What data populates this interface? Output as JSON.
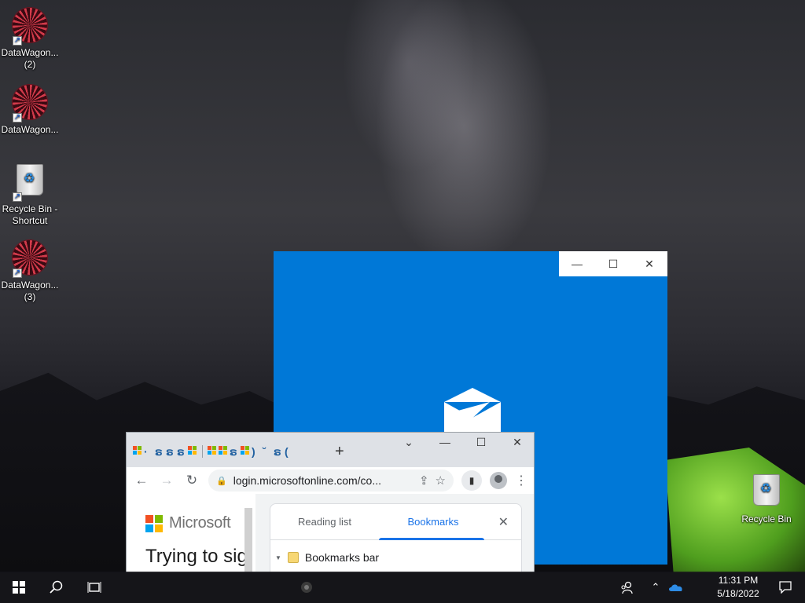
{
  "desktop": {
    "icons": [
      {
        "label_line1": "DataWagon...",
        "label_line2": "(2)",
        "icon": "datawagon-icon"
      },
      {
        "label_line1": "DataWagon...",
        "label_line2": "",
        "icon": "datawagon-icon"
      },
      {
        "label_line1": "Recycle Bin -",
        "label_line2": "Shortcut",
        "icon": "recycle-bin-icon"
      },
      {
        "label_line1": "DataWagon...",
        "label_line2": "(3)",
        "icon": "datawagon-icon"
      },
      {
        "label_line1": "Recycle Bin",
        "label_line2": "",
        "icon": "recycle-bin-icon"
      }
    ]
  },
  "mail_window": {
    "controls": {
      "minimize": "—",
      "maximize": "☐",
      "close": "✕"
    },
    "accent": "#0078d7"
  },
  "chrome": {
    "new_tab": "+",
    "tab_search": "⌄",
    "minimize": "—",
    "maximize": "☐",
    "close": "✕",
    "back": "←",
    "forward": "→",
    "reload": "↻",
    "url": "login.microsoftonline.com/co...",
    "page": {
      "brand": "Microsoft",
      "title": "Trying to sig"
    },
    "side_panel": {
      "tabs": [
        "Reading list",
        "Bookmarks"
      ],
      "active_tab": "Bookmarks",
      "close": "✕",
      "bookmarks_folder": "Bookmarks bar"
    }
  },
  "taskbar": {
    "time": "11:31 PM",
    "date": "5/18/2022"
  }
}
